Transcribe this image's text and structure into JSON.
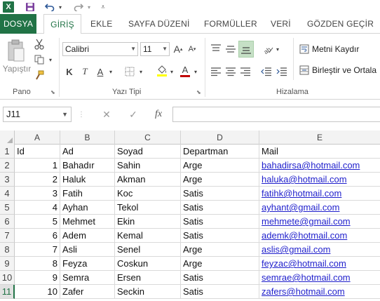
{
  "qat": {
    "logo": "X",
    "save_icon": "save-icon",
    "undo_icon": "undo-icon",
    "redo_icon": "redo-icon",
    "customize_icon": "customize-icon"
  },
  "tabs": [
    {
      "label": "DOSYA"
    },
    {
      "label": "GİRİŞ"
    },
    {
      "label": "EKLE"
    },
    {
      "label": "SAYFA DÜZENİ"
    },
    {
      "label": "FORMÜLLER"
    },
    {
      "label": "VERİ"
    },
    {
      "label": "GÖZDEN GEÇİR"
    }
  ],
  "ribbon": {
    "clipboard": {
      "paste_label": "Yapıştır",
      "group_label": "Pano"
    },
    "font": {
      "name": "Calibri",
      "size": "11",
      "group_label": "Yazı Tipi",
      "bold": "K",
      "italic": "T",
      "underline": "A",
      "grow": "A",
      "shrink": "A",
      "font_color": "A"
    },
    "alignment": {
      "wrap_label": "Metni Kaydır",
      "merge_label": "Birleştir ve Ortala",
      "group_label": "Hizalama"
    }
  },
  "formula_bar": {
    "name_box": "J11",
    "cancel": "✕",
    "enter": "✓",
    "fx": "fx",
    "value": ""
  },
  "columns": [
    "A",
    "B",
    "C",
    "D",
    "E"
  ],
  "rows": [
    {
      "num": "1",
      "cells": [
        "Id",
        "Ad",
        "Soyad",
        "Departman",
        "Mail"
      ]
    },
    {
      "num": "2",
      "cells": [
        "1",
        "Bahadır",
        "Sahin",
        "Arge",
        "bahadirsa@hotmail.com"
      ]
    },
    {
      "num": "3",
      "cells": [
        "2",
        "Haluk",
        "Akman",
        "Arge",
        "haluka@hotmail.com"
      ]
    },
    {
      "num": "4",
      "cells": [
        "3",
        "Fatih",
        "Koc",
        "Satis",
        "fatihk@hotmail.com"
      ]
    },
    {
      "num": "5",
      "cells": [
        "4",
        "Ayhan",
        "Tekol",
        "Satis",
        "ayhant@gmail.com"
      ]
    },
    {
      "num": "6",
      "cells": [
        "5",
        "Mehmet",
        "Ekin",
        "Satis",
        "mehmete@gmail.com"
      ]
    },
    {
      "num": "7",
      "cells": [
        "6",
        "Adem",
        "Kemal",
        "Satis",
        "ademk@hotmail.com"
      ]
    },
    {
      "num": "8",
      "cells": [
        "7",
        "Asli",
        "Senel",
        "Arge",
        "aslis@gmail.com"
      ]
    },
    {
      "num": "9",
      "cells": [
        "8",
        "Feyza",
        "Coskun",
        "Arge",
        "feyzac@hotmail.com"
      ]
    },
    {
      "num": "10",
      "cells": [
        "9",
        "Semra",
        "Ersen",
        "Satis",
        "semrae@hotmail.com"
      ]
    },
    {
      "num": "11",
      "cells": [
        "10",
        "Zafer",
        "Seckin",
        "Satis",
        "zafers@hotmail.com"
      ]
    }
  ],
  "colors": {
    "accent": "#217346",
    "link": "#1f1fcc",
    "font_color_bar": "#c00000",
    "highlight_bar": "#ffff00"
  }
}
